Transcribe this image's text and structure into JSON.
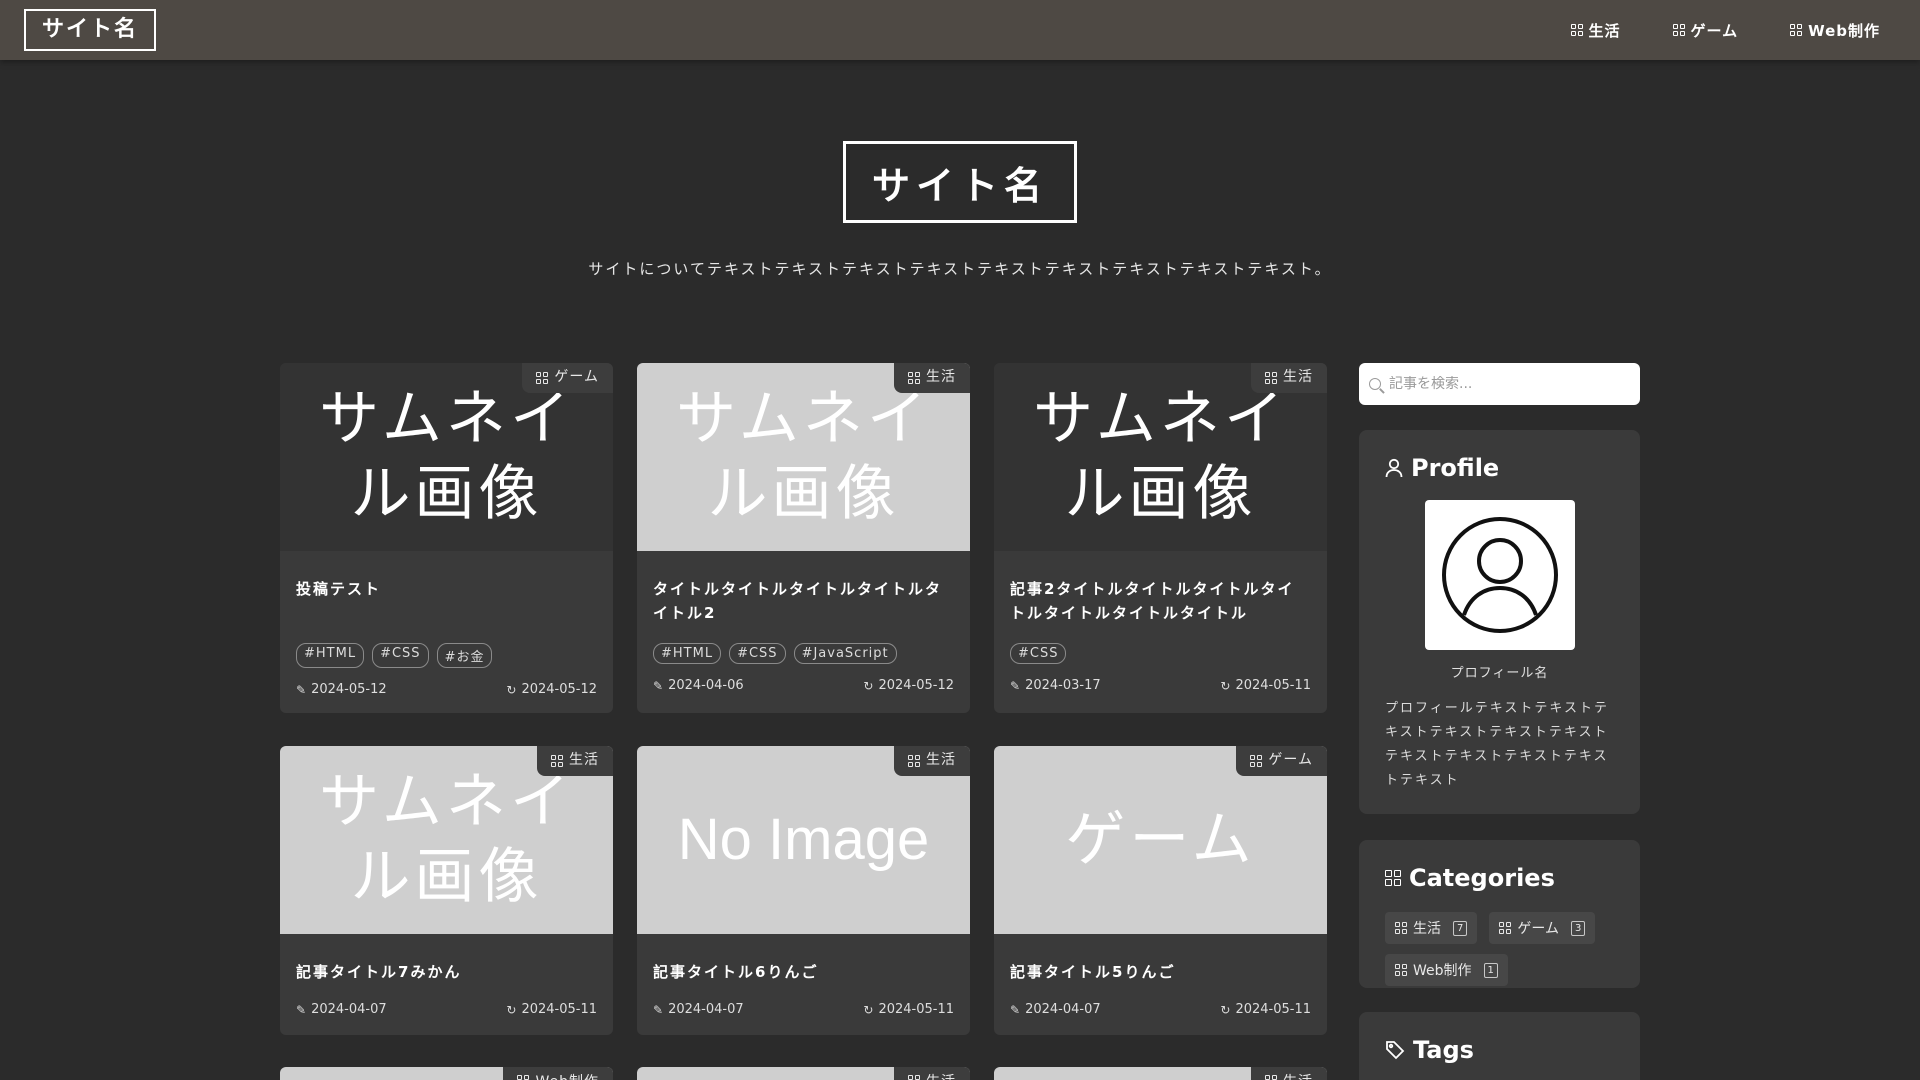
{
  "header": {
    "site_name": "サイト名",
    "nav": [
      {
        "label": "生活"
      },
      {
        "label": "ゲーム"
      },
      {
        "label": "Web制作"
      }
    ]
  },
  "hero": {
    "site_name": "サイト名",
    "description": "サイトについてテキストテキストテキストテキストテキストテキストテキストテキストテキスト。"
  },
  "cards": [
    {
      "category": "ゲーム",
      "thumb": "サムネイル画像",
      "title": "投稿テスト",
      "tags": [
        "#HTML",
        "#CSS",
        "#お金"
      ],
      "created": "2024-05-12",
      "updated": "2024-05-12"
    },
    {
      "category": "生活",
      "thumb": "サムネイル画像",
      "title": "タイトルタイトルタイトルタイトルタイトル2",
      "tags": [
        "#HTML",
        "#CSS",
        "#JavaScript"
      ],
      "created": "2024-04-06",
      "updated": "2024-05-12"
    },
    {
      "category": "生活",
      "thumb": "サムネイル画像",
      "title": "記事2タイトルタイトルタイトルタイトルタイトルタイトルタイトル",
      "tags": [
        "#CSS"
      ],
      "created": "2024-03-17",
      "updated": "2024-05-11"
    },
    {
      "category": "生活",
      "thumb": "サムネイル画像",
      "title": "記事タイトル7みかん",
      "tags": [],
      "created": "2024-04-07",
      "updated": "2024-05-11"
    },
    {
      "category": "生活",
      "thumb": "No Image",
      "title": "記事タイトル6りんご",
      "tags": [],
      "created": "2024-04-07",
      "updated": "2024-05-11"
    },
    {
      "category": "ゲーム",
      "thumb": "ゲーム",
      "title": "記事タイトル5りんご",
      "tags": [],
      "created": "2024-04-07",
      "updated": "2024-05-11"
    }
  ],
  "next_row_categories": [
    "Web制作",
    "生活",
    "生活"
  ],
  "sidebar": {
    "search_placeholder": "記事を検索...",
    "profile": {
      "title": "Profile",
      "name": "プロフィール名",
      "text": "プロフィールテキストテキストテキストテキストテキストテキストテキストテキストテキストテキストテキスト"
    },
    "categories": {
      "title": "Categories",
      "items": [
        {
          "label": "生活",
          "count": "7"
        },
        {
          "label": "ゲーム",
          "count": "3"
        },
        {
          "label": "Web制作",
          "count": "1"
        }
      ]
    },
    "tags": {
      "title": "Tags"
    }
  }
}
